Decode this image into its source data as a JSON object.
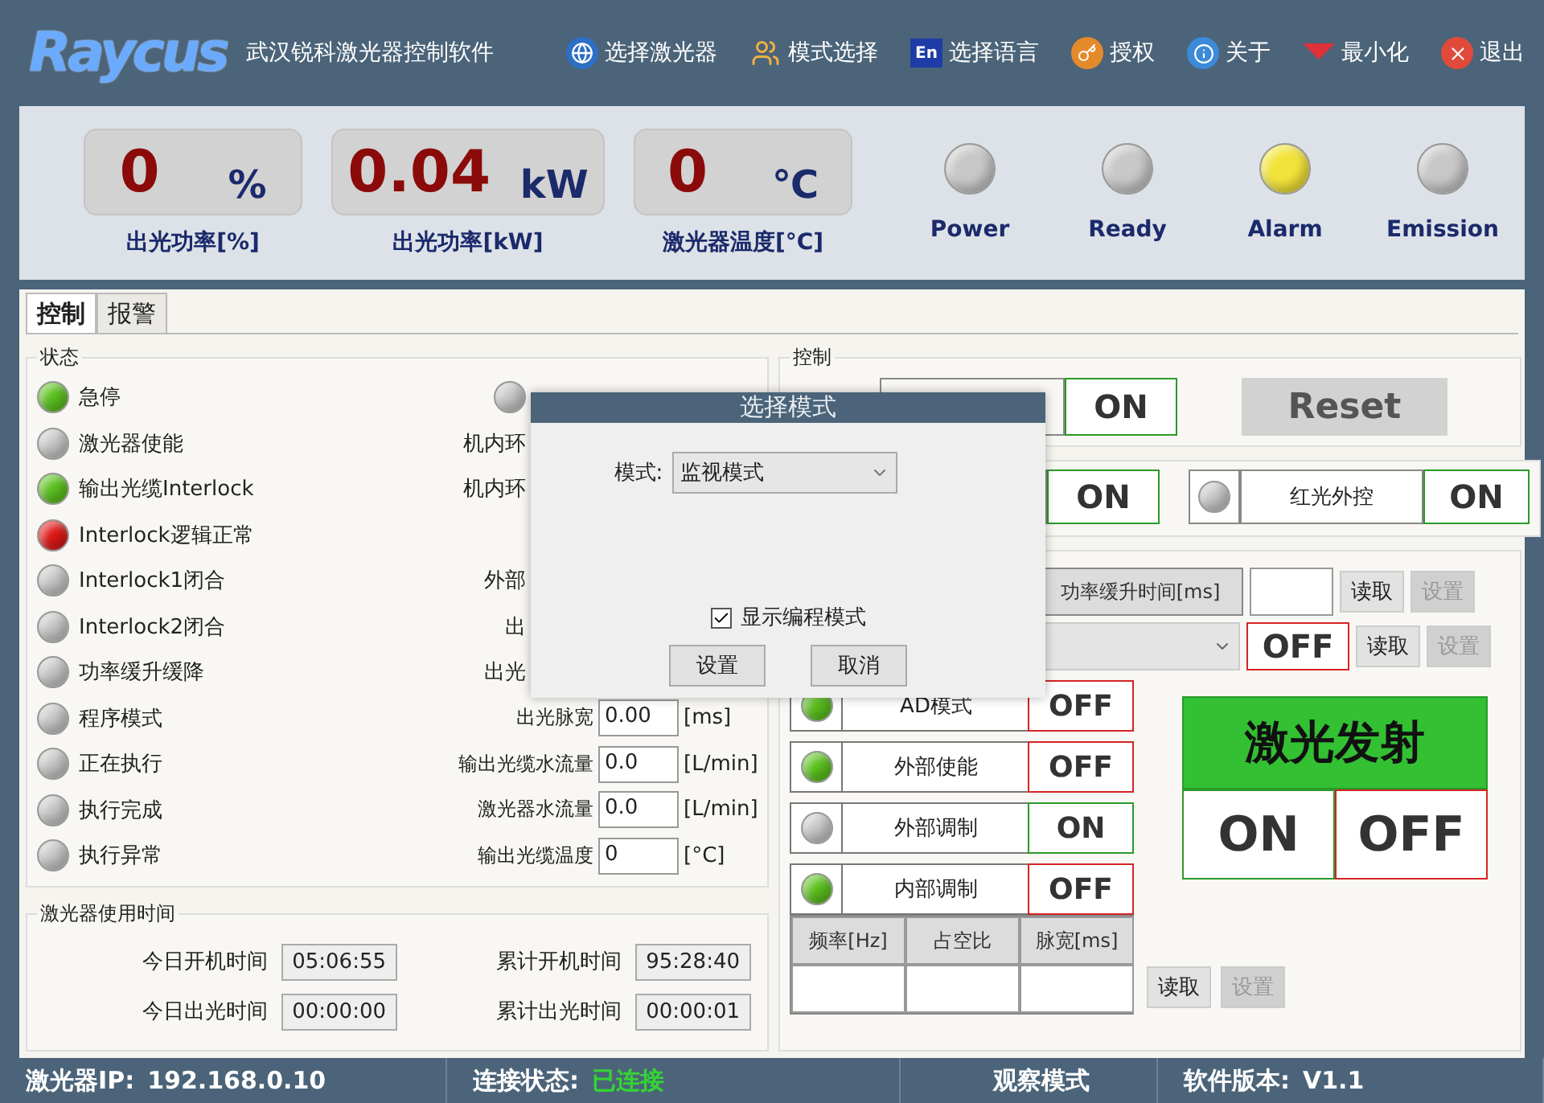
{
  "header": {
    "logo": "Raycus",
    "title": "武汉锐科激光器控制软件",
    "menu": [
      {
        "kind": "globe",
        "label": "选择激光器"
      },
      {
        "kind": "users",
        "label": "模式选择"
      },
      {
        "kind": "lang",
        "icon_text": "En",
        "label": "选择语言"
      },
      {
        "kind": "key",
        "label": "授权"
      },
      {
        "kind": "info",
        "label": "关于"
      },
      {
        "kind": "minimize",
        "label": "最小化"
      },
      {
        "kind": "exit",
        "label": "退出"
      }
    ]
  },
  "readouts": [
    {
      "value": "0",
      "unit": "%",
      "label": "出光功率[%]"
    },
    {
      "value": "0.04",
      "unit": "kW",
      "label": "出光功率[kW]"
    },
    {
      "value": "0",
      "unit": "℃",
      "label": "激光器温度[°C]"
    }
  ],
  "indicators": [
    {
      "label": "Power",
      "color": "#c8c8c8"
    },
    {
      "label": "Ready",
      "color": "#c8c8c8"
    },
    {
      "label": "Alarm",
      "color": "#f2e33a"
    },
    {
      "label": "Emission",
      "color": "#c8c8c8"
    }
  ],
  "tabs": [
    {
      "label": "控制",
      "selected": true
    },
    {
      "label": "报警",
      "selected": false
    }
  ],
  "status": {
    "title": "状态",
    "items": [
      {
        "label": "急停",
        "color": "#5cc21e"
      },
      {
        "label": "激光器使能",
        "color": "#c8c8c8"
      },
      {
        "label": "输出光缆Interlock",
        "color": "#5cc21e"
      },
      {
        "label": "Interlock逻辑正常",
        "color": "#e01818"
      },
      {
        "label": "Interlock1闭合",
        "color": "#c8c8c8"
      },
      {
        "label": "Interlock2闭合",
        "color": "#c8c8c8"
      },
      {
        "label": "功率缓升缓降",
        "color": "#c8c8c8"
      },
      {
        "label": "程序模式",
        "color": "#c8c8c8"
      },
      {
        "label": "正在执行",
        "color": "#c8c8c8"
      },
      {
        "label": "执行完成",
        "color": "#c8c8c8"
      },
      {
        "label": "执行异常",
        "color": "#c8c8c8"
      }
    ]
  },
  "readings": [
    {
      "kind": "lamp",
      "color": "#c8c8c8"
    },
    {
      "kind": "covered",
      "label": "机内环"
    },
    {
      "kind": "covered",
      "label": "机内环"
    },
    {
      "kind": "blank"
    },
    {
      "kind": "covered",
      "label": "外部"
    },
    {
      "kind": "covered",
      "label": "出"
    },
    {
      "kind": "covered",
      "label": "出光"
    },
    {
      "kind": "field",
      "label": "出光脉宽",
      "value": "0.00",
      "unit": "[ms]"
    },
    {
      "kind": "field",
      "label": "输出光缆水流量",
      "value": "0.0",
      "unit": "[L/min]"
    },
    {
      "kind": "field",
      "label": "激光器水流量",
      "value": "0.0",
      "unit": "[L/min]"
    },
    {
      "kind": "field",
      "label": "输出光缆温度",
      "value": "0",
      "unit": "[°C]"
    }
  ],
  "usage": {
    "title": "激光器使用时间",
    "items": [
      {
        "label": "今日开机时间",
        "value": "05:06:55"
      },
      {
        "label": "累计开机时间",
        "value": "95:28:40"
      },
      {
        "label": "今日出光时间",
        "value": "00:00:00"
      },
      {
        "label": "累计出光时间",
        "value": "00:00:01"
      }
    ]
  },
  "control": {
    "title": "控制",
    "power": {
      "state": "ON",
      "on": true
    },
    "reset": "Reset",
    "aiming": {
      "state": "ON",
      "on": true
    },
    "red_light": {
      "label": "红光外控",
      "color": "#c8c8c8",
      "state": "ON",
      "on": true
    }
  },
  "settings": {
    "ramp": {
      "label": "功率缓升时间[ms]",
      "read": "读取",
      "set": "设置",
      "set_disabled": true
    },
    "select_row": {
      "state": "OFF",
      "on": false,
      "read": "读取",
      "set": "设置",
      "set_disabled": true
    },
    "modes": [
      {
        "label": "AD模式",
        "color": "#5cc21e",
        "state": "OFF",
        "on": false
      },
      {
        "label": "外部使能",
        "color": "#5cc21e",
        "state": "OFF",
        "on": false
      },
      {
        "label": "外部调制",
        "color": "#c8c8c8",
        "state": "ON",
        "on": true
      },
      {
        "label": "内部调制",
        "color": "#5cc21e",
        "state": "OFF",
        "on": false
      }
    ],
    "table": {
      "columns": [
        "频率[Hz]",
        "占空比",
        "脉宽[ms]"
      ]
    },
    "read": "读取",
    "set": "设置",
    "set_disabled": true,
    "emission": {
      "title": "激光发射",
      "on_label": "ON",
      "off_label": "OFF"
    }
  },
  "status_bar": [
    {
      "label": "激光器IP:",
      "value": "192.168.0.10",
      "kind": "plain"
    },
    {
      "label": "连接状态:",
      "value": "已连接",
      "kind": "good"
    },
    {
      "label": "观察模式"
    },
    {
      "label": "软件版本:",
      "value": "V1.1",
      "kind": "plain"
    }
  ],
  "dialog": {
    "title": "选择模式",
    "mode_label": "模式:",
    "mode_value": "监视模式",
    "checkbox": {
      "label": "显示编程模式",
      "checked": true
    },
    "buttons": [
      "设置",
      "取消"
    ]
  }
}
